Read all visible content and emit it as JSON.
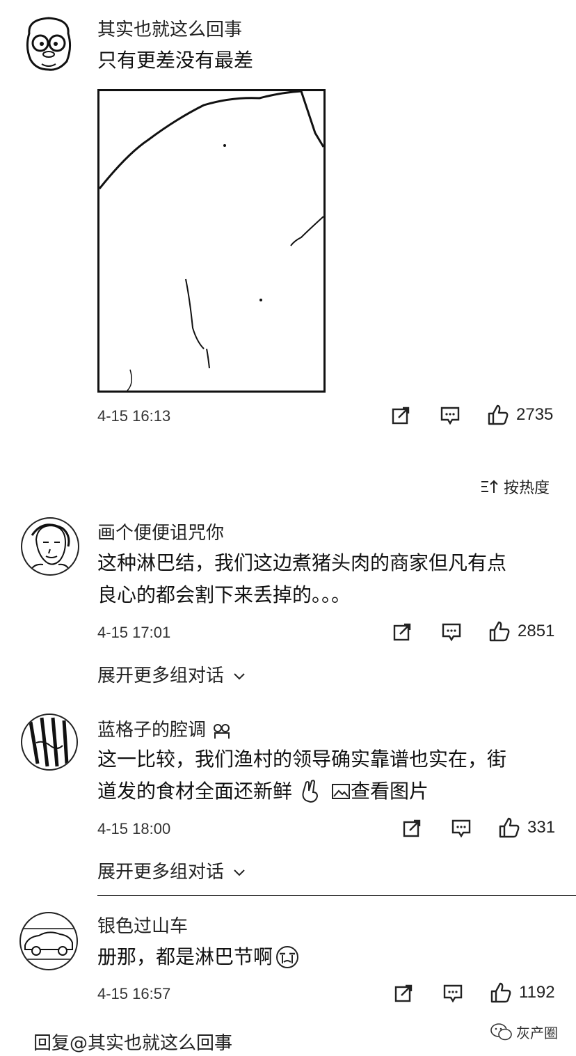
{
  "comments": [
    {
      "username": "其实也就这么回事",
      "text_lines": [
        "只有更差没有最差"
      ],
      "timestamp": "4-15 16:13",
      "likes": "2735"
    },
    {
      "username": "画个便便诅咒你",
      "text_lines": [
        "这种淋巴结，我们这边煮猪头肉的商家但凡有点",
        "良心的都会割下来丢掉的。。。"
      ],
      "timestamp": "4-15 17:01",
      "likes": "2851",
      "expand_label": "展开更多组对话"
    },
    {
      "username": "蓝格子的腔调",
      "text_lines": [
        "这一比较，我们渔村的领导确实靠谱也实在，街",
        "道发的食材全面还新鲜"
      ],
      "view_image_label": "查看图片",
      "timestamp": "4-15 18:00",
      "likes": "331",
      "expand_label": "展开更多组对话"
    },
    {
      "username": "银色过山车",
      "text_lines": [
        "册那，都是淋巴节啊"
      ],
      "timestamp": "4-15 16:57",
      "likes": "1192"
    }
  ],
  "sort_label": "按热度",
  "reply_prefix": "回复",
  "reply_target": "@其实也就这么回事",
  "watermark": "灰产圈",
  "icons": {
    "share": "share-icon",
    "comment": "comment-icon",
    "like": "thumbs-up-icon",
    "sort": "sort-icon",
    "chevron": "chevron-down-icon",
    "image": "image-icon",
    "wechat": "wechat-icon"
  }
}
